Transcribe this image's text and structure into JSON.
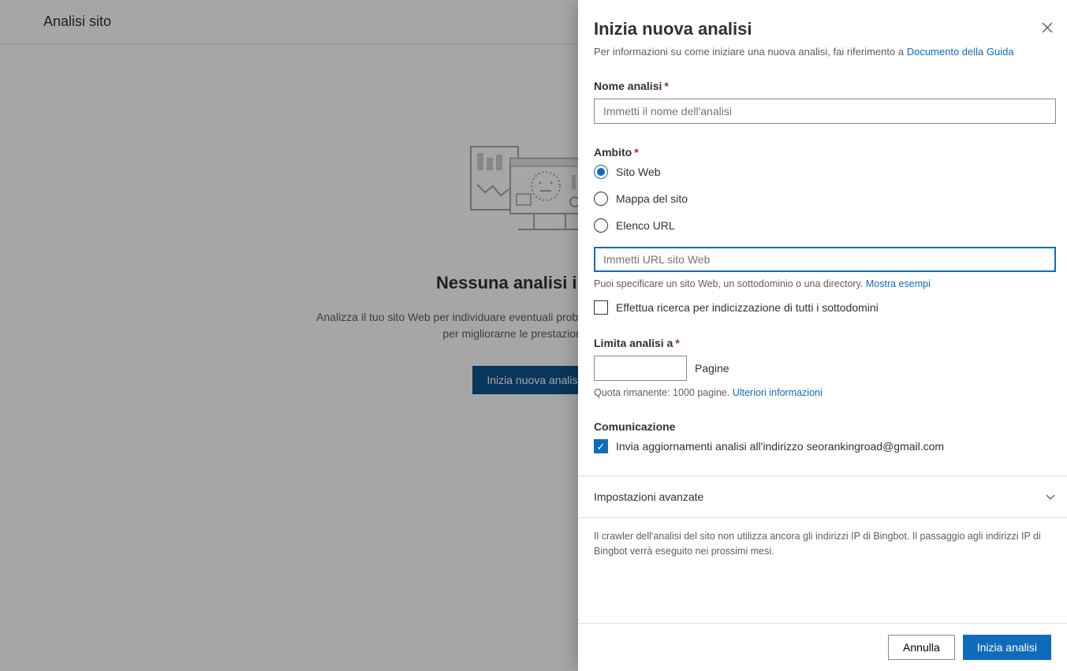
{
  "header": {
    "title": "Analisi sito"
  },
  "empty": {
    "heading": "Nessuna analisi iniziata",
    "desc": "Analizza il tuo sito Web per individuare eventuali problemi tecnici SEO correggerli risolvili per migliorarne le prestazioni in Bing.",
    "start_btn": "Inizia nuova analisi"
  },
  "panel": {
    "title": "Inizia nuova analisi",
    "subtitle_prefix": "Per informazioni su come iniziare una nuova analisi, fai riferimento a ",
    "subtitle_link": "Documento della Guida",
    "name_label": "Nome analisi",
    "name_placeholder": "Immetti il nome dell'analisi",
    "scope_label": "Ambito",
    "scope_options": {
      "website": "Sito Web",
      "sitemap": "Mappa del sito",
      "urllist": "Elenco URL"
    },
    "url_placeholder": "Immetti URL sito Web",
    "url_hint_prefix": "Puoi specificare un sito Web, un sottodominio o una directory. ",
    "url_hint_link": "Mostra esempi",
    "subdomains_checkbox": "Effettua ricerca per indicizzazione di tutti i sottodomini",
    "limit_label": "Limita analisi a",
    "pages_unit": "Pagine",
    "quota_prefix": "Quota rimanente: 1000 pagine. ",
    "quota_link": "Ulteriori informazioni",
    "comm_label": "Comunicazione",
    "comm_checkbox": "Invia aggiornamenti analisi all'indirizzo seorankingroad@gmail.com",
    "advanced": "Impostazioni avanzate",
    "crawler_note": "Il crawler dell'analisi del sito non utilizza ancora gli indirizzi IP di Bingbot. Il passaggio agli indirizzi IP di Bingbot verrà eseguito nei prossimi mesi.",
    "cancel_btn": "Annulla",
    "start_btn": "Inizia analisi"
  }
}
